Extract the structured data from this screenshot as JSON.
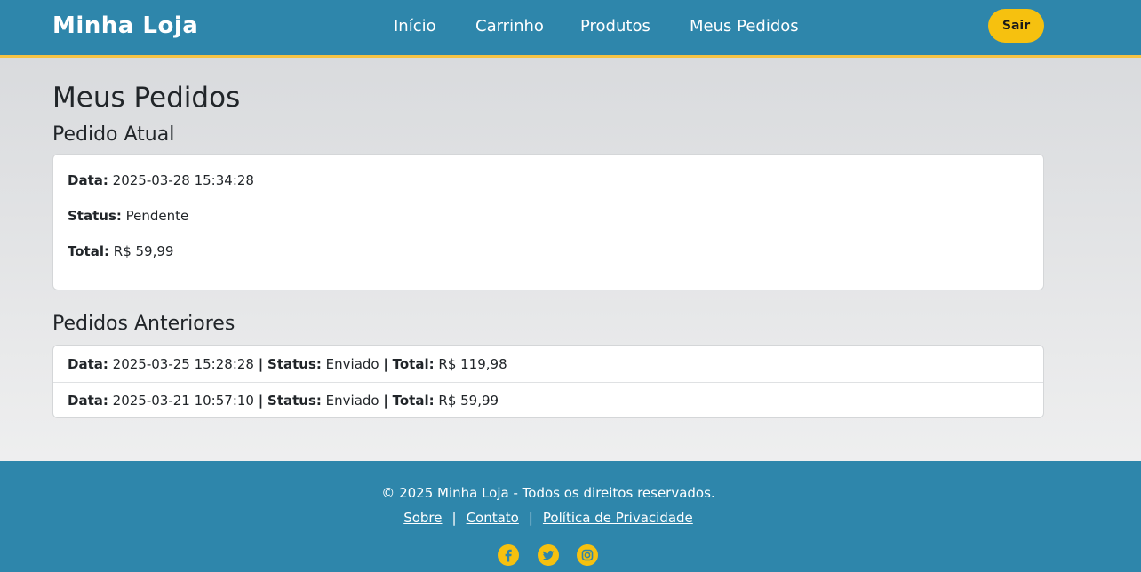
{
  "header": {
    "brand": "Minha Loja",
    "nav": [
      "Início",
      "Carrinho",
      "Produtos",
      "Meus Pedidos"
    ],
    "logout_label": "Sair"
  },
  "main": {
    "title": "Meus Pedidos",
    "current": {
      "heading": "Pedido Atual",
      "date_label": "Data:",
      "date": "2025-03-28 15:34:28",
      "status_label": "Status:",
      "status": "Pendente",
      "total_label": "Total:",
      "total": "R$ 59,99"
    },
    "previous": {
      "heading": "Pedidos Anteriores",
      "sep": "|",
      "labels": {
        "date": "Data:",
        "status": "Status:",
        "total": "Total:"
      },
      "orders": [
        {
          "date": "2025-03-25 15:28:28",
          "status": "Enviado",
          "total": "R$ 119,98"
        },
        {
          "date": "2025-03-21 10:57:10",
          "status": "Enviado",
          "total": "R$ 59,99"
        }
      ]
    }
  },
  "footer": {
    "copyright": "© 2025 Minha Loja - Todos os direitos reservados.",
    "links": [
      "Sobre",
      "Contato",
      "Política de Privacidade"
    ],
    "sep": "|",
    "social": [
      "facebook-icon",
      "twitter-icon",
      "instagram-icon"
    ],
    "social_color": "#f6c10f"
  },
  "colors": {
    "primary": "#2e86ab",
    "accent": "#f6c10f"
  }
}
